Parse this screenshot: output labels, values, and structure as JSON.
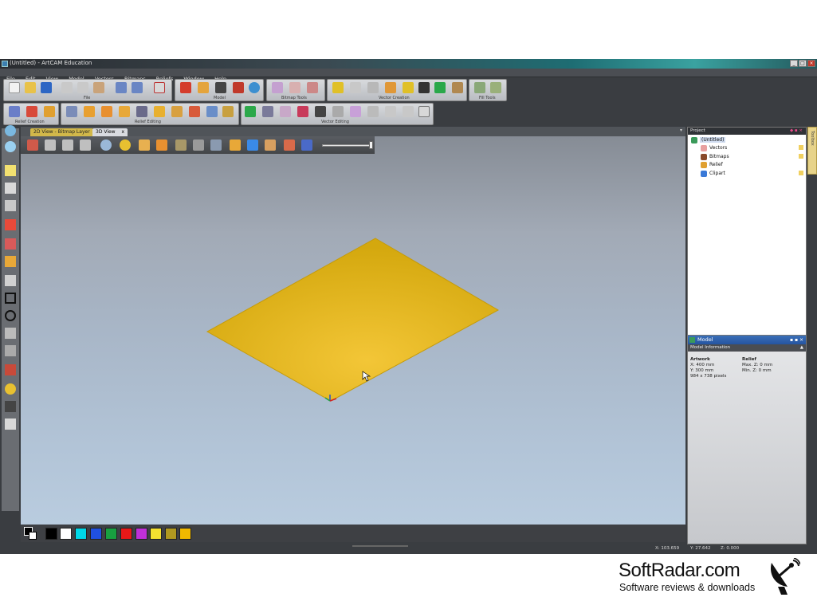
{
  "window": {
    "title": "(Untitled) - ArtCAM Education",
    "controls": [
      "_",
      "□",
      "×"
    ]
  },
  "menu": [
    "File",
    "Edit",
    "View",
    "Model",
    "Vectors",
    "Bitmaps",
    "Reliefs",
    "Window",
    "Help"
  ],
  "toolbar_groups": [
    {
      "label": "File"
    },
    {
      "label": "Model"
    },
    {
      "label": "Bitmap Tools"
    },
    {
      "label": "Vector Creation"
    },
    {
      "label": "Fill Tools"
    },
    {
      "label": "Relief Creation"
    },
    {
      "label": "Relief Editing"
    },
    {
      "label": "Vector Editing"
    }
  ],
  "tabs": [
    {
      "label": "2D View - Bitmap Layer",
      "active": false
    },
    {
      "label": "3D View",
      "active": true,
      "close": "x"
    }
  ],
  "project": {
    "header": "Project",
    "root": "(Untitled)",
    "items": [
      "Vectors",
      "Bitmaps",
      "Relief",
      "Clipart"
    ]
  },
  "model": {
    "header": "Model",
    "subheader": "Model Information",
    "artwork_title": "Artwork",
    "artwork_lines": [
      "X: 400 mm",
      "Y: 300 mm",
      "984 x 738 pixels"
    ],
    "relief_title": "Relief",
    "relief_lines": [
      "Max. Z: 0 mm",
      "Min. Z: 0 mm"
    ]
  },
  "toolbox_label": "Toolbox",
  "status": {
    "x": "X: 103.659",
    "y": "Y: 27.642",
    "z": "Z: 0.000"
  },
  "palette": {
    "colors": [
      "#000000",
      "#ffffff",
      "#00d8e8",
      "#2050e0",
      "#18a040",
      "#e81818",
      "#c030d8",
      "#f4e030",
      "#b09820",
      "#f0b800"
    ]
  },
  "colors": {
    "plane": "#e0b310",
    "accent": "#2554a0"
  },
  "watermark": {
    "title": "SoftRadar.com",
    "subtitle": "Software reviews & downloads"
  }
}
